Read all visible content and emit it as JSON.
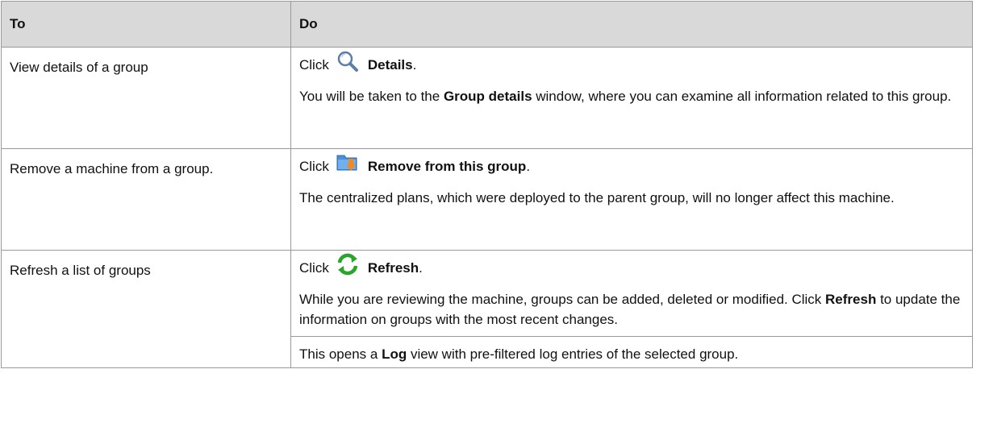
{
  "table": {
    "header": {
      "to": "To",
      "do": "Do"
    },
    "rows": [
      {
        "to": "View details of a group",
        "click_prefix": "Click",
        "icon": "magnifier-icon",
        "action": "Details",
        "action_suffix": ".",
        "desc_parts": [
          "You will be taken to the ",
          "Group details",
          " window, where you can examine all information related to this group."
        ]
      },
      {
        "to": "Remove a machine from a group.",
        "click_prefix": "Click",
        "icon": "folder-remove-icon",
        "action": "Remove from this group",
        "action_suffix": ".",
        "desc_parts": [
          "The centralized plans, which were deployed to the parent group, will no longer affect this machine."
        ]
      },
      {
        "to": "Refresh a list of groups",
        "click_prefix": "Click",
        "icon": "refresh-icon",
        "action": "Refresh",
        "action_suffix": ".",
        "desc_parts": [
          "While you are reviewing the machine, groups can be added, deleted or modified. Click ",
          "Refresh",
          " to update the information on groups with the most recent changes."
        ]
      }
    ],
    "last_row": {
      "to": "",
      "desc_parts": [
        "This opens a ",
        "Log",
        " view with pre-filtered log entries of the selected group."
      ]
    }
  },
  "colors": {
    "header_bg": "#d9d9d9",
    "border": "#999999",
    "magnifier": "#5a7fa8",
    "folder": "#4a8fd8",
    "arrow": "#f08a24",
    "refresh": "#2aa52a"
  }
}
